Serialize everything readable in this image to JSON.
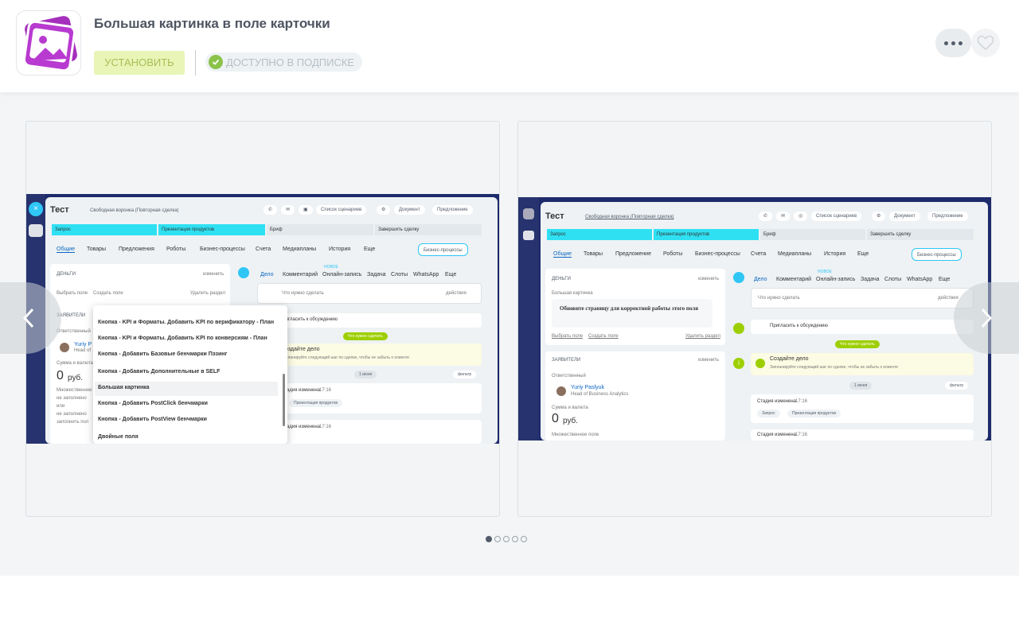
{
  "header": {
    "title": "Большая картинка в поле карточки",
    "install_label": "УСТАНОВИТЬ",
    "subscription_label": "ДОСТУПНО В ПОДПИСКЕ",
    "icon": "app-image-icon",
    "accent": "#bbed21"
  },
  "gallery": {
    "slide_count": 5,
    "active_index": 0,
    "slide1": {
      "title": "Тест",
      "funnel": "Свободная воронка (Повторная сделка)",
      "scenarios": "Список сценариев",
      "document": "Документ",
      "offer": "Предложение",
      "stages": [
        "Запрос",
        "Презентация продуктов",
        "Бриф",
        "Завершить сделку"
      ],
      "tabs": [
        "Общие",
        "Товары",
        "Предложения",
        "Роботы",
        "Бизнес-процессы",
        "Счета",
        "Медиапланы",
        "История",
        "Еще"
      ],
      "bp_button": "Бизнес-процессы",
      "section_money": "ДЕНЬГИ",
      "change": "изменить",
      "choose_field": "Выбрать поле",
      "create_field": "Создать поле",
      "delete_section": "Удалить раздел",
      "section_about": "ЗАЯВИТЕЛИ",
      "responsible": "Ответственный",
      "responsible_name": "Yuriy P",
      "responsible_role": "Head of",
      "sum_label": "Сумма и валюта",
      "sum_value": "0",
      "currency": "руб.",
      "multi_field": "Множественное поле",
      "not_filled": "не заполнено",
      "or": "или",
      "fill_field": "заполнить пол",
      "activity_tabs": [
        "Дело",
        "Комментарий",
        "Онлайн-запись",
        "Задача",
        "Слоты",
        "WhatsApp",
        "Еще"
      ],
      "new_badge": "НОВОЕ",
      "todo_placeholder": "Что нужно сделать",
      "actions": "действия",
      "invite": "Пригласить к обсуждению",
      "need_todo": "Что нужно сделать",
      "create_task": "Создайте дело",
      "plan_hint": "Запланируйте следующий шаг по сделке, чтобы не забыть о клиенте",
      "date_pill": "1 июня",
      "filter": "фильтр",
      "stage_changed": "Стадия изменена",
      "time": "17:16",
      "stage_pill": "Презентация продуктов",
      "dropdown_items": [
        "Кнопка - KPI и Форматы. Добавить KPI по верификатору - План",
        "Кнопка - KPI и Форматы. Добавить KPI по конверсиям - План",
        "Кнопка - Добавить Базовые бенчмарки Пэзинг",
        "Кнопка - Добавить Дополнительные в SELF",
        "Большая картинка",
        "Кнопка - Добавить PostClick бенчмарки",
        "Кнопка - Добавить PostView бенчмарки",
        "Двойные поля"
      ]
    },
    "slide2": {
      "title": "Тест",
      "funnel": "Свободная воронка (Повторная сделка)",
      "scenarios": "Список сценариев",
      "document": "Документ",
      "offer": "Предложение",
      "stages": [
        "Запрос",
        "Презентация продуктов",
        "Бриф",
        "Завершить сделку"
      ],
      "tabs": [
        "Общие",
        "Товары",
        "Предложение",
        "Роботы",
        "Бизнес-процессы",
        "Счета",
        "Медиапланы",
        "История",
        "Еще"
      ],
      "bp_button": "Бизнес-процессы",
      "section_money": "ДЕНЬГИ",
      "change": "изменить",
      "big_picture": "Большая картинка",
      "image_alt": "Обновите страницу для корректной работы этого поля",
      "choose_field": "Выбрать поле",
      "create_field": "Создать поле",
      "delete_section": "Удалить раздел",
      "section_about": "ЗАЯВИТЕЛИ",
      "responsible": "Ответственный",
      "responsible_name": "Yuriy Paslyuk",
      "responsible_role": "Head of Business Analytics",
      "sum_label": "Сумма и валюта",
      "sum_value": "0",
      "currency": "руб.",
      "multi_field": "Множественное поле",
      "activity_tabs": [
        "Дело",
        "Комментарий",
        "Онлайн-запись",
        "Задача",
        "Слоты",
        "WhatsApp",
        "Еще"
      ],
      "new_badge": "НОВОЕ",
      "todo_placeholder": "Что нужно сделать",
      "actions": "действия",
      "invite": "Пригласить к обсуждению",
      "need_todo": "Что нужно сделать",
      "create_task": "Создайте дело",
      "plan_hint": "Запланируйте следующий шаг по сделке, чтобы не забыть о клиенте",
      "date_pill": "1 июня",
      "filter": "фильтр",
      "stage_changed": "Стадия изменена",
      "time": "17:16",
      "from_stage": "Запрос",
      "to_stage": "Презентация продуктов"
    }
  }
}
